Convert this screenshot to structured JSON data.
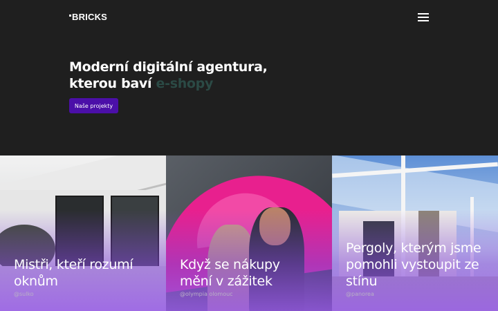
{
  "header": {
    "logo": "BRICKS",
    "menu_icon": "hamburger-icon"
  },
  "hero": {
    "headline_line1": "Moderní digitální agentura,",
    "headline_line2_prefix": "kterou baví ",
    "headline_accent": "e-shopy",
    "cta_label": "Naše projekty"
  },
  "colors": {
    "background": "#1f1f1f",
    "cta": "#4b0fa8",
    "accent_text": "#2b4a45"
  },
  "cards": [
    {
      "title": "Mistři, kteří rozumí oknům",
      "handle": "@sulko"
    },
    {
      "title": "Když se nákupy mění v zážitek",
      "handle": "@olympia olomouc"
    },
    {
      "title": "Pergoly, kterým jsme pomohli vystoupit ze stínu",
      "handle": "@panorea"
    }
  ]
}
